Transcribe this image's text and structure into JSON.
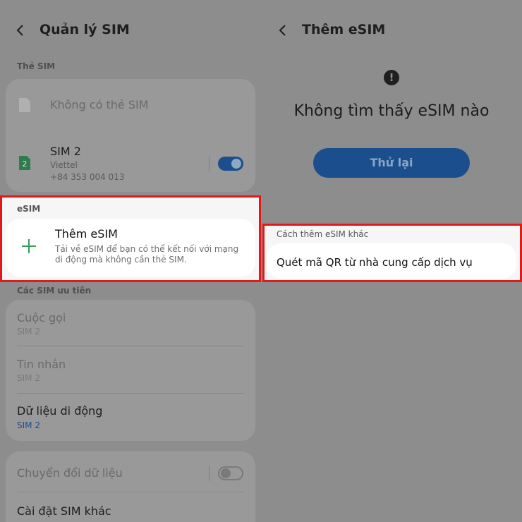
{
  "left": {
    "title": "Quản lý SIM",
    "sim_cards_label": "Thẻ SIM",
    "no_sim_label": "Không có thẻ SIM",
    "sim2": {
      "badge": "2",
      "name": "SIM 2",
      "carrier": "Viettel",
      "number": "+84 353 004 013",
      "enabled": true
    },
    "esim_label": "eSIM",
    "add_esim": {
      "title": "Thêm eSIM",
      "desc": "Tải về eSIM để bạn có thể kết nối với mạng di động mà không cần thẻ SIM."
    },
    "preferred_label": "Các SIM ưu tiên",
    "preferred": [
      {
        "title": "Cuộc gọi",
        "value": "SIM 2"
      },
      {
        "title": "Tin nhắn",
        "value": "SIM 2"
      },
      {
        "title": "Dữ liệu di động",
        "value": "SIM 2"
      }
    ],
    "data_switch": {
      "label": "Chuyển đổi dữ liệu",
      "enabled": false
    },
    "other_settings": "Cài đặt SIM khác"
  },
  "right": {
    "title": "Thêm eSIM",
    "warn_glyph": "!",
    "not_found": "Không tìm thấy eSIM nào",
    "retry_label": "Thử lại",
    "other_ways_label": "Cách thêm eSIM khác",
    "scan_qr": "Quét mã QR từ nhà cung cấp dịch vụ"
  },
  "colors": {
    "highlight": "#e11919",
    "toggle_on": "#1a4e8c",
    "plus": "#3a9b5a",
    "sim_badge": "#2e7d4a"
  }
}
